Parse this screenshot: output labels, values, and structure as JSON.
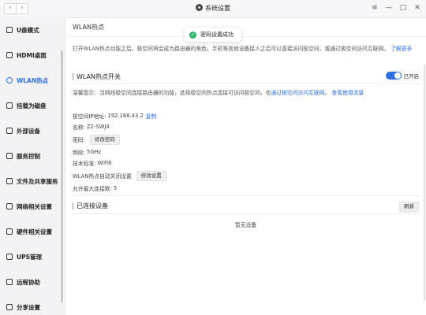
{
  "window": {
    "title": "系统设置",
    "back": "‹",
    "forward": "›",
    "controls": {
      "menu": "≡",
      "minimize": "—",
      "maximize": "□",
      "close": "✕"
    }
  },
  "sidebar": {
    "items": [
      {
        "label": "U盘模式",
        "icon": "usb-icon"
      },
      {
        "label": "HDMI桌面",
        "icon": "monitor-icon"
      },
      {
        "label": "WLAN热点",
        "icon": "wifi-icon",
        "active": true
      },
      {
        "label": "挂载为磁盘",
        "icon": "disk-icon"
      },
      {
        "label": "外部设备",
        "icon": "device-icon"
      },
      {
        "label": "服务控制",
        "icon": "service-icon"
      },
      {
        "label": "文件及共享服务",
        "icon": "share-icon"
      },
      {
        "label": "网络相关设置",
        "icon": "network-icon"
      },
      {
        "label": "硬件相关设置",
        "icon": "hardware-icon"
      },
      {
        "label": "UPS管理",
        "icon": "ups-icon"
      },
      {
        "label": "远程协助",
        "icon": "remote-icon"
      },
      {
        "label": "分享设置",
        "icon": "share-settings-icon"
      }
    ]
  },
  "main": {
    "page_title": "WLAN热点",
    "intro_text": "打开WLAN热点功能之后，极空间将会成为路由器的角色，手机等其他设备接入之后可以直接访问极空间，或通过极空间访问互联网。",
    "intro_link": "了解更多",
    "hotspot_section": {
      "title": "WLAN热点开关",
      "toggle_label": "已开启",
      "toggle_on": true,
      "notice_text": "温馨提示：当网线极空间连接路由器的功能，选择极空间热点连接可访问极空间，也",
      "notice_link_text": "通过极空间访问互联网",
      "notice_tail": "。",
      "more_link": "查看使用流量",
      "details": {
        "address_label": "极空间IP地址:",
        "address_value": "192.168.43.2",
        "copy_link": "复制",
        "name_label": "名称:",
        "name_value": "Z2-SWJ4",
        "password_label": "密码:",
        "password_button": "修改密码",
        "band_label": "频段:",
        "band_value": "5GHz",
        "standard_label": "技术标准:",
        "standard_value": "WiFi6",
        "auto_off_label": "WLAN热点自动关闭设置",
        "auto_off_button": "修改设置",
        "max_devices_label": "允许最大连接数:",
        "max_devices_value": "5"
      }
    },
    "connected_section": {
      "title": "已连接设备",
      "refresh_button": "刷新",
      "empty_text": "暂无设备"
    }
  },
  "toast": {
    "text": "密码设置成功",
    "icon": "check-circle-icon",
    "color": "#2eb56c"
  },
  "colors": {
    "accent": "#2f6fe0",
    "success": "#2eb56c"
  }
}
